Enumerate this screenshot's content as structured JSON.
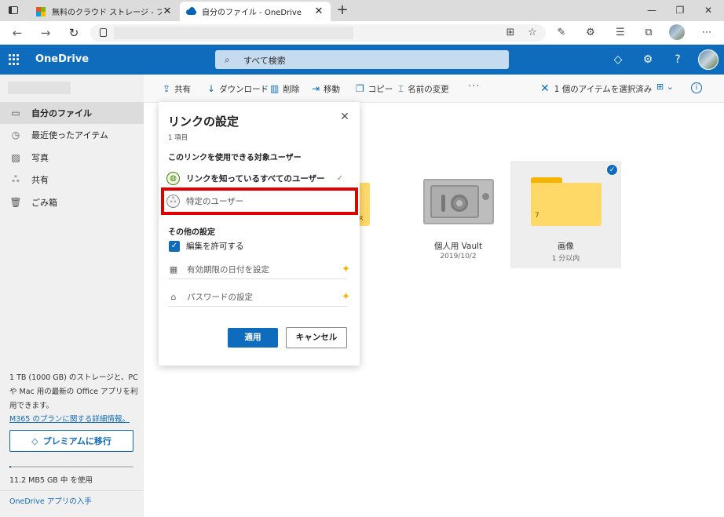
{
  "browser": {
    "tabs": [
      {
        "title": "無料のクラウド ストレージ - ファイル共"
      },
      {
        "title": "自分のファイル - OneDrive"
      }
    ],
    "new_tab": "+",
    "close_glyph": "✕",
    "win": {
      "minimize": "—",
      "restore": "❐",
      "close": "✕"
    }
  },
  "od_header": {
    "brand": "OneDrive",
    "search_placeholder": "すべて検索"
  },
  "sidebar": {
    "items": [
      {
        "label": "自分のファイル",
        "icon": "folder-icon"
      },
      {
        "label": "最近使ったアイテム",
        "icon": "clock-icon"
      },
      {
        "label": "写真",
        "icon": "photo-icon"
      },
      {
        "label": "共有",
        "icon": "people-icon"
      },
      {
        "label": "ごみ箱",
        "icon": "trash-icon"
      }
    ],
    "storage_text": "1 TB (1000 GB) のストレージと、PC や Mac 用の最新の Office アプリを利用できます。",
    "storage_link": "M365 のプランに関する詳細情報。",
    "premium_button": "プレミアムに移行",
    "usage_text": "11.2 MB5 GB 中 を使用",
    "usage_fraction": 0.002,
    "get_app": "OneDrive アプリの入手"
  },
  "commandbar": {
    "share": "共有",
    "download": "ダウンロード",
    "delete": "削除",
    "move": "移動",
    "copy": "コピー",
    "rename": "名前の変更",
    "more": "···",
    "selection": "1 個のアイテムを選択済み"
  },
  "files": [
    {
      "name": "個人用 Vault",
      "sub": "2019/10/2",
      "type": "vault"
    },
    {
      "name": "画像",
      "sub": "1 分以内",
      "type": "folder",
      "count": "7",
      "selected": true
    }
  ],
  "partial_letter": "R",
  "dialog": {
    "title": "リンクの設定",
    "count": "1 項目",
    "audience_heading": "このリンクを使用できる対象ユーザー",
    "options": [
      {
        "label": "リンクを知っているすべてのユーザー",
        "selected": true
      },
      {
        "label": "特定のユーザー",
        "selected": false
      }
    ],
    "other_heading": "その他の設定",
    "allow_edit": "編集を許可する",
    "expiry": "有効期限の日付を設定",
    "password": "パスワードの設定",
    "apply": "適用",
    "cancel": "キャンセル",
    "close_glyph": "✕"
  },
  "colors": {
    "accent": "#0f6cbd",
    "highlight": "#e00000",
    "folder": "#ffd968"
  }
}
